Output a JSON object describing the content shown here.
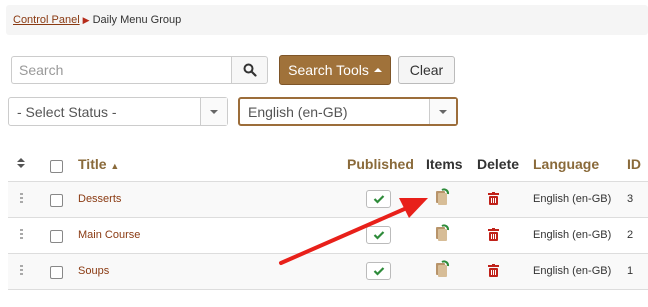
{
  "breadcrumb": {
    "root": "Control Panel",
    "current": "Daily Menu Group"
  },
  "search": {
    "placeholder": "Search",
    "tools_label": "Search Tools",
    "clear_label": "Clear"
  },
  "filters": {
    "status": "- Select Status -",
    "language": "English (en-GB)"
  },
  "table": {
    "headers": {
      "title": "Title",
      "published": "Published",
      "items": "Items",
      "delete": "Delete",
      "language": "Language",
      "id": "ID"
    },
    "rows": [
      {
        "title": "Desserts",
        "language": "English (en-GB)",
        "id": "3"
      },
      {
        "title": "Main Course",
        "language": "English (en-GB)",
        "id": "2"
      },
      {
        "title": "Soups",
        "language": "English (en-GB)",
        "id": "1"
      }
    ]
  },
  "colors": {
    "accent": "#a0723a",
    "link": "#8a3a12",
    "published_check": "#2e8b3a",
    "delete": "#c0221a",
    "annotation_arrow": "#e8201a"
  },
  "icons": {
    "search": "search-icon",
    "items": "items-icon",
    "delete": "trash-icon",
    "published": "check-icon",
    "sort": "sort-icon",
    "drag": "drag-handle-icon"
  }
}
